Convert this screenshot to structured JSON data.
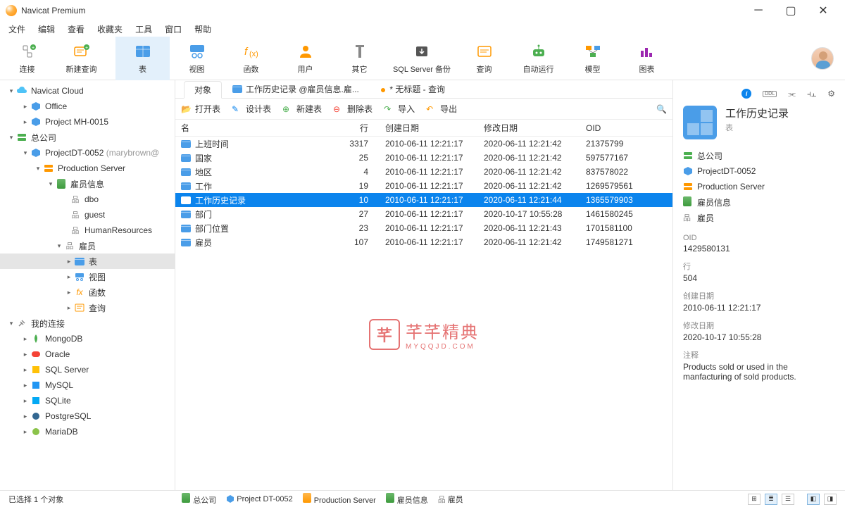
{
  "title": "Navicat Premium",
  "menu": [
    "文件",
    "编辑",
    "查看",
    "收藏夹",
    "工具",
    "窗口",
    "帮助"
  ],
  "toolbar": [
    {
      "id": "connect",
      "label": "连接"
    },
    {
      "id": "newquery",
      "label": "新建查询"
    },
    {
      "id": "table",
      "label": "表",
      "active": true
    },
    {
      "id": "view",
      "label": "视图"
    },
    {
      "id": "function",
      "label": "函数"
    },
    {
      "id": "user",
      "label": "用户"
    },
    {
      "id": "other",
      "label": "其它"
    },
    {
      "id": "sqlbackup",
      "label": "SQL Server 备份"
    },
    {
      "id": "query",
      "label": "查询"
    },
    {
      "id": "autorun",
      "label": "自动运行"
    },
    {
      "id": "model",
      "label": "模型"
    },
    {
      "id": "chart",
      "label": "图表"
    }
  ],
  "tree": [
    {
      "pad": 10,
      "chev": "▾",
      "icon": "cloud",
      "label": "Navicat Cloud"
    },
    {
      "pad": 30,
      "chev": "▸",
      "icon": "hex-blue",
      "label": "Office"
    },
    {
      "pad": 30,
      "chev": "▸",
      "icon": "hex-blue",
      "label": "Project MH-0015"
    },
    {
      "pad": 10,
      "chev": "▾",
      "icon": "server-green",
      "label": "总公司"
    },
    {
      "pad": 30,
      "chev": "▾",
      "icon": "hex-blue",
      "label": "ProjectDT-0052",
      "suffix": " (marybrown@"
    },
    {
      "pad": 48,
      "chev": "▾",
      "icon": "server-yellow",
      "label": "Production Server"
    },
    {
      "pad": 66,
      "chev": "▾",
      "icon": "cyl",
      "label": "雇员信息"
    },
    {
      "pad": 86,
      "chev": "",
      "icon": "schema",
      "label": "dbo"
    },
    {
      "pad": 86,
      "chev": "",
      "icon": "schema",
      "label": "guest"
    },
    {
      "pad": 86,
      "chev": "",
      "icon": "schema",
      "label": "HumanResources"
    },
    {
      "pad": 78,
      "chev": "▾",
      "icon": "schema",
      "label": "雇员"
    },
    {
      "pad": 92,
      "chev": "▸",
      "icon": "table",
      "label": "表",
      "selected": true
    },
    {
      "pad": 92,
      "chev": "▸",
      "icon": "view",
      "label": "视图"
    },
    {
      "pad": 92,
      "chev": "▸",
      "icon": "fx",
      "label": "函数"
    },
    {
      "pad": 92,
      "chev": "▸",
      "icon": "query",
      "label": "查询"
    },
    {
      "pad": 10,
      "chev": "▾",
      "icon": "plug",
      "label": "我的连接"
    },
    {
      "pad": 30,
      "chev": "▸",
      "icon": "mongo",
      "label": "MongoDB"
    },
    {
      "pad": 30,
      "chev": "▸",
      "icon": "oracle",
      "label": "Oracle"
    },
    {
      "pad": 30,
      "chev": "▸",
      "icon": "mssql",
      "label": "SQL Server"
    },
    {
      "pad": 30,
      "chev": "▸",
      "icon": "mysql",
      "label": "MySQL"
    },
    {
      "pad": 30,
      "chev": "▸",
      "icon": "sqlite",
      "label": "SQLite"
    },
    {
      "pad": 30,
      "chev": "▸",
      "icon": "pg",
      "label": "PostgreSQL"
    },
    {
      "pad": 30,
      "chev": "▸",
      "icon": "maria",
      "label": "MariaDB"
    }
  ],
  "tabs": {
    "obj": "对象",
    "t1": "工作历史记录 @雇员信息.雇...",
    "t2": "* 无标题 - 查询"
  },
  "objbar": {
    "open": "打开表",
    "design": "设计表",
    "new": "新建表",
    "del": "删除表",
    "import": "导入",
    "export": "导出"
  },
  "headers": {
    "name": "名",
    "rows": "行",
    "created": "创建日期",
    "modified": "修改日期",
    "oid": "OID"
  },
  "rows": [
    {
      "name": "上班时间",
      "rows": "3317",
      "cr": "2010-06-11 12:21:17",
      "md": "2020-06-11 12:21:42",
      "oid": "21375799"
    },
    {
      "name": "国家",
      "rows": "25",
      "cr": "2010-06-11 12:21:17",
      "md": "2020-06-11 12:21:42",
      "oid": "597577167"
    },
    {
      "name": "地区",
      "rows": "4",
      "cr": "2010-06-11 12:21:17",
      "md": "2020-06-11 12:21:42",
      "oid": "837578022"
    },
    {
      "name": "工作",
      "rows": "19",
      "cr": "2010-06-11 12:21:17",
      "md": "2020-06-11 12:21:42",
      "oid": "1269579561"
    },
    {
      "name": "工作历史记录",
      "rows": "10",
      "cr": "2010-06-11 12:21:17",
      "md": "2020-06-11 12:21:44",
      "oid": "1365579903",
      "sel": true
    },
    {
      "name": "部门",
      "rows": "27",
      "cr": "2010-06-11 12:21:17",
      "md": "2020-10-17 10:55:28",
      "oid": "1461580245"
    },
    {
      "name": "部门位置",
      "rows": "23",
      "cr": "2010-06-11 12:21:17",
      "md": "2020-06-11 12:21:43",
      "oid": "1701581100"
    },
    {
      "name": "雇员",
      "rows": "107",
      "cr": "2010-06-11 12:21:17",
      "md": "2020-06-11 12:21:42",
      "oid": "1749581271"
    }
  ],
  "detail": {
    "title": "工作历史记录",
    "sub": "表",
    "path": [
      "总公司",
      "ProjectDT-0052",
      "Production Server",
      "雇员信息",
      "雇员"
    ],
    "oid_k": "OID",
    "oid_v": "1429580131",
    "rows_k": "行",
    "rows_v": "504",
    "cr_k": "创建日期",
    "cr_v": "2010-06-11 12:21:17",
    "md_k": "修改日期",
    "md_v": "2020-10-17 10:55:28",
    "note_k": "注释",
    "note_v": "Products sold or used in the manfacturing of sold products."
  },
  "status": {
    "sel": "已选择 1 个对象",
    "crumbs": [
      "总公司",
      "Project DT-0052",
      "Production Server",
      "雇员信息",
      "雇员"
    ]
  },
  "watermark": {
    "text": "芊芊精典",
    "sub": "MYQQJD.COM"
  }
}
